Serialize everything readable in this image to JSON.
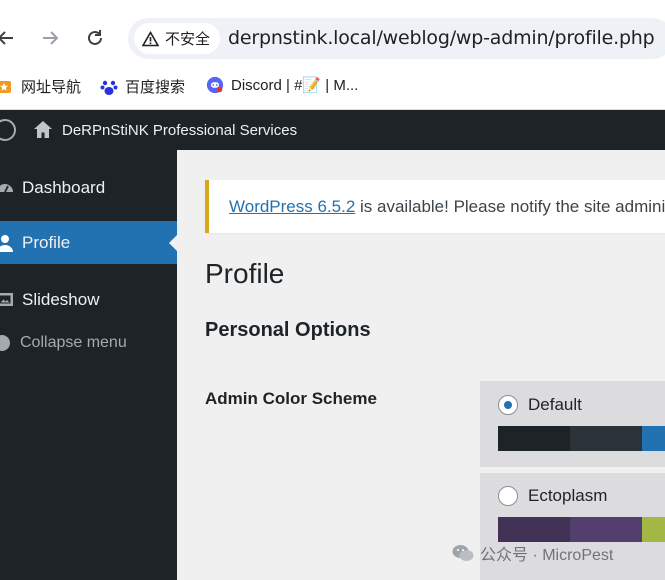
{
  "browser": {
    "security_label": "不安全",
    "url": "derpnstink.local/weblog/wp-admin/profile.php"
  },
  "bookmarks": [
    {
      "label": "网址导航",
      "icon": "bookmark-star-icon"
    },
    {
      "label": "百度搜索",
      "icon": "baidu-paw-icon"
    },
    {
      "label": "Discord | #📝 | M...",
      "icon": "discord-icon"
    }
  ],
  "adminbar": {
    "site_name": "DeRPnStiNK Professional Services"
  },
  "sidebar": {
    "items": [
      {
        "label": "Dashboard",
        "icon": "dashboard-icon",
        "active": false
      },
      {
        "label": "Profile",
        "icon": "user-icon",
        "active": true
      },
      {
        "label": "Slideshow",
        "icon": "slideshow-icon",
        "active": false
      }
    ],
    "collapse_label": "Collapse menu"
  },
  "content": {
    "notice": {
      "link_text": "WordPress 6.5.2",
      "rest_text": " is available! Please notify the site admini"
    },
    "page_title": "Profile",
    "section_title": "Personal Options",
    "color_scheme_label": "Admin Color Scheme",
    "schemes": [
      {
        "label": "Default",
        "selected": true,
        "colors": [
          "#1d2327",
          "#2c3338",
          "#2271b1",
          "#72aee6"
        ]
      },
      {
        "label": "Ectoplasm",
        "selected": false,
        "colors": [
          "#413256",
          "#523f6d",
          "#a3b745",
          "#d46f15"
        ]
      }
    ]
  },
  "watermark": "公众号 · MicroPest",
  "colors": {
    "admin_dark": "#1d2327",
    "accent_blue": "#2271b1",
    "notice_yellow": "#dba617"
  }
}
